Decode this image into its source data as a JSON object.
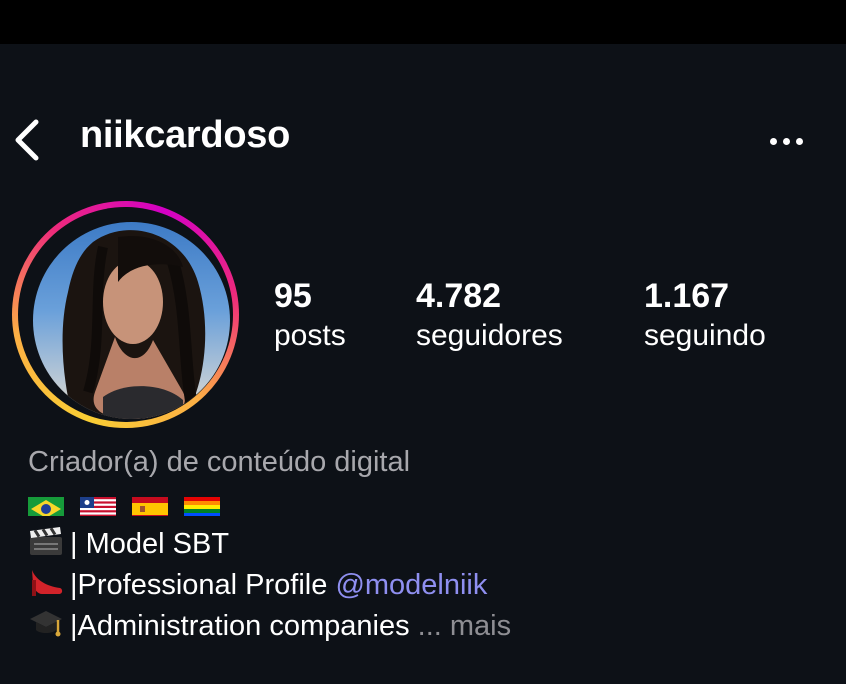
{
  "profile": {
    "username": "niikcardoso",
    "stats": [
      {
        "value": "95",
        "label": "posts"
      },
      {
        "value": "4.782",
        "label": "seguidores"
      },
      {
        "value": "1.167",
        "label": "seguindo"
      }
    ],
    "bio": {
      "category": "Criador(a) de conteúdo digital",
      "flags": [
        "brazil-flag-icon",
        "liberia-flag-icon",
        "spain-flag-icon",
        "rainbow-flag-icon"
      ],
      "line1_emoji": "clapperboard-icon",
      "line1_text": "| Model SBT",
      "line2_emoji": "high-heel-icon",
      "line2_text": "|Professional Profile ",
      "line2_mention": "@modelniik",
      "line3_emoji": "graduation-cap-icon",
      "line3_text": "|Administration companies",
      "ellipsis": " ... ",
      "more_label": "mais"
    }
  },
  "colors": {
    "background": "#0d1117",
    "mention": "#8f8ff0",
    "muted": "#a8a8ad"
  }
}
